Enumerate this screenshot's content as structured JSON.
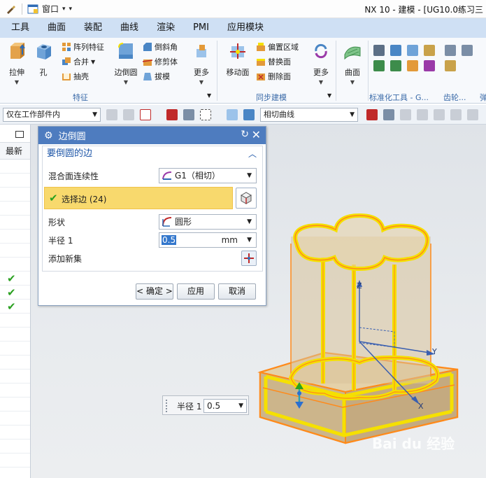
{
  "window": {
    "quick_access_window": "窗口",
    "title": "NX 10 - 建模 - [UG10.0练习三"
  },
  "menu": [
    "工具",
    "曲面",
    "装配",
    "曲线",
    "渲染",
    "PMI",
    "应用模块"
  ],
  "ribbon": {
    "feature_group": {
      "label": "特征",
      "extrude": "拉伸",
      "hole": "孔",
      "pattern_feature": "阵列特征",
      "unite": "合并",
      "shell": "抽壳",
      "edge_blend": "边倒圆",
      "chamfer": "倒斜角",
      "trim_body": "修剪体",
      "draft": "拔模",
      "more": "更多"
    },
    "sync_group": {
      "label": "同步建模",
      "move_face": "移动面",
      "offset_region": "偏置区域",
      "replace_face": "替换面",
      "delete_face": "删除面",
      "more": "更多"
    },
    "surface_group": {
      "surface": "曲面"
    },
    "standard_tools_label": "标准化工具 - G...",
    "gear_label": "齿轮...",
    "spring_label": "弹"
  },
  "selection_bar": {
    "filter_scope": "仅在工作部件内",
    "curve_rule": "相切曲线"
  },
  "left_panel": {
    "column_header": "最新",
    "checked_rows": [
      8,
      9,
      10
    ]
  },
  "dialog": {
    "title": "边倒圆",
    "section_title": "要倒圆的边",
    "blend_continuity_label": "混合面连续性",
    "blend_continuity_value": "G1（相切）",
    "select_edge_label": "选择边 (24)",
    "shape_label": "形状",
    "shape_value": "圆形",
    "radius_label": "半径 1",
    "radius_value": "0.5",
    "radius_unit": "mm",
    "add_new_set_label": "添加新集",
    "ok_button": "< 确定 >",
    "apply_button": "应用",
    "cancel_button": "取消"
  },
  "radius_popup": {
    "label": "半径 1",
    "value": "0.5"
  },
  "viewport": {
    "axis_x": "X",
    "axis_y": "Y",
    "axis_z": "Z"
  },
  "colors": {
    "menubar": "#cfe0f4",
    "dialog_title": "#4e7cbf",
    "selection_highlight": "#f8d96d",
    "model_edge_highlight": "#f5e000",
    "model_outline": "#ff8a1a",
    "model_body": "#d9c29a"
  }
}
